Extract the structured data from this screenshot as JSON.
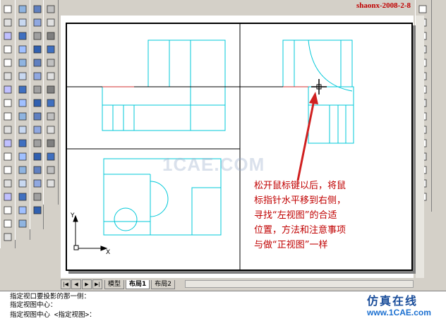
{
  "title": "shaonx-2008-2-8",
  "layout_tabs": [
    {
      "label": "模型"
    },
    {
      "label": "布局1",
      "active": true
    },
    {
      "label": "布局2"
    }
  ],
  "annotation_lines": [
    "松开鼠标键以后，将鼠",
    "标指针水平移到右侧，",
    "寻找“左视图”的合适",
    "位置，方法和注意事项",
    "与做“正视图”一样"
  ],
  "watermark": "1CAE.COM",
  "ucs": {
    "x_label": "X",
    "y_label": "Y"
  },
  "command_lines": [
    "指定视口要投影的那一侧：",
    "指定视图中心：",
    "指定视图中心 <指定视图>："
  ],
  "brand": {
    "name": "仿真在线",
    "url": "www.1CAE.com"
  },
  "colors": {
    "drawing": "#00c8d8",
    "annotation": "#c00000",
    "arrow": "#d02020",
    "crosshair": "#000000"
  }
}
